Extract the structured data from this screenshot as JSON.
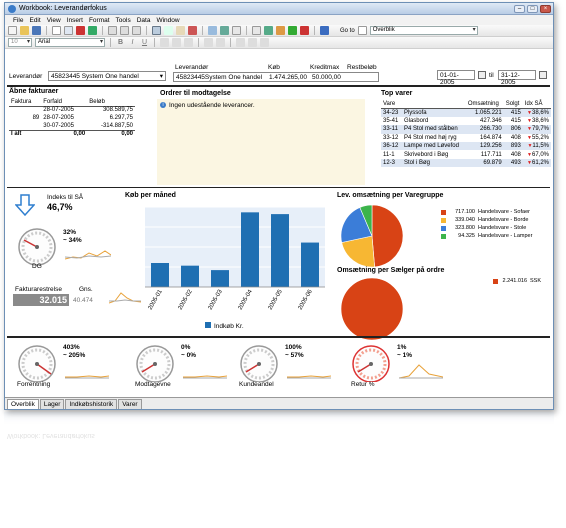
{
  "window": {
    "title": "Workbook: Leverandørfokus"
  },
  "menu": [
    "File",
    "Edit",
    "View",
    "Insert",
    "Format",
    "Tools",
    "Data",
    "Window"
  ],
  "toolbar": {
    "font_size": "10",
    "font_name": "Arial",
    "goto_label": "Go to",
    "goto_value": "Overblik"
  },
  "filters": {
    "supplier_label": "Leverandør",
    "supplier_value": "45823445 System One handel",
    "date_from": "01-01-2005",
    "date_sep": "til",
    "date_to": "31-12-2005"
  },
  "summary": {
    "headers": [
      "Leverandør",
      "Køb",
      "Kreditmax",
      "Restbeløb"
    ],
    "values": [
      "45823445System One handel",
      "1.474.265,00",
      "50.000,00",
      ""
    ]
  },
  "invoices": {
    "title": "Åbne fakturaer",
    "headers": [
      "Faktura",
      "Forfald",
      "Beløb"
    ],
    "rows": [
      [
        "",
        "28-07-2005",
        "308.589,75"
      ],
      [
        "89",
        "28-07-2005",
        "6.297,75"
      ],
      [
        "",
        "30-07-2005",
        "-314.887,50"
      ]
    ],
    "total_label": "I alt",
    "total_a": "0,00",
    "total_b": "0,00"
  },
  "orders": {
    "title": "Ordrer til modtagelse",
    "info": "Ingen udestående leverancer."
  },
  "top": {
    "title": "Top varer",
    "headers": [
      "Vare",
      "Omsætning",
      "Solgt",
      "Idx SÅ"
    ],
    "rows": [
      {
        "code": "34-23",
        "name": "Plyssofa",
        "rev": "1.065.221",
        "sold": "415",
        "dir": "down",
        "idx": "38,6%"
      },
      {
        "code": "35-41",
        "name": "Glasbord",
        "rev": "427.346",
        "sold": "415",
        "dir": "down",
        "idx": "38,6%"
      },
      {
        "code": "33-11",
        "name": "P4 Stol med stålben",
        "rev": "266.730",
        "sold": "806",
        "dir": "down",
        "idx": "79,7%"
      },
      {
        "code": "33-12",
        "name": "P4 Stol med høj ryg",
        "rev": "164.874",
        "sold": "408",
        "dir": "down",
        "idx": "55,2%"
      },
      {
        "code": "36-12",
        "name": "Lampe med Løvefod",
        "rev": "129.256",
        "sold": "893",
        "dir": "down",
        "idx": "11,5%"
      },
      {
        "code": "11-1",
        "name": "Skrivebord i Bøg",
        "rev": "117.711",
        "sold": "408",
        "dir": "down",
        "idx": "67,0%"
      },
      {
        "code": "12-3",
        "name": "Stol i Bøg",
        "rev": "69.879",
        "sold": "493",
        "dir": "down",
        "idx": "61,2%"
      }
    ]
  },
  "kpi": {
    "index_label": "Indeks til SÅ",
    "index_value": "46,7%",
    "db_pct1": "32%",
    "db_pct2": "~ 34%",
    "db_label": "DG",
    "rest_label": "Fakturarestrelse",
    "rest_value": "32.015",
    "avg_label": "Gns.",
    "avg_value": "40.474"
  },
  "chart_data": [
    {
      "type": "bar",
      "title": "Køb per måned",
      "categories": [
        "2005-01",
        "2005-02",
        "2005-03",
        "2005-04",
        "2005-05",
        "2005-06"
      ],
      "series": [
        {
          "name": "Indkøb Kr.",
          "values": [
            135000,
            120000,
            95000,
            420000,
            410000,
            250000
          ]
        }
      ],
      "ylim": [
        0,
        450000
      ],
      "color": "#1f6fb2"
    },
    {
      "type": "pie",
      "title": "Lev. omsætning per Varegruppe",
      "labels": [
        "Handelsvare - Sofaer",
        "Handelsvare - Borde",
        "Handelsvare - Stole",
        "Handelsvare - Lamper"
      ],
      "values": [
        717100,
        339040,
        323800,
        94325
      ],
      "value_labels": [
        "717.100",
        "339.040",
        "323.800",
        "94.325"
      ],
      "colors": [
        "#d84315",
        "#f7b733",
        "#3b7dd8",
        "#3cb44b"
      ]
    },
    {
      "type": "pie",
      "title": "Omsætning per Sælger på ordre",
      "labels": [
        "SSK"
      ],
      "values": [
        2241016
      ],
      "value_labels": [
        "2.241.016"
      ],
      "colors": [
        "#d84315"
      ]
    }
  ],
  "gauges": [
    {
      "pct1": "403%",
      "pct2": "~ 205%",
      "label": "Forrentning"
    },
    {
      "pct1": "0%",
      "pct2": "~ 0%",
      "label": "Modtagevne"
    },
    {
      "pct1": "100%",
      "pct2": "~ 57%",
      "label": "Kundeandel"
    },
    {
      "pct1": "1%",
      "pct2": "~ 1%",
      "label": "Retur %"
    }
  ],
  "tabs": [
    "Overblik",
    "Lager",
    "Indkøbshistorik",
    "Varer"
  ],
  "colors": {
    "accent": "#1f6fb2",
    "down": "#dd2222",
    "header_bg": "#b9cde6"
  }
}
